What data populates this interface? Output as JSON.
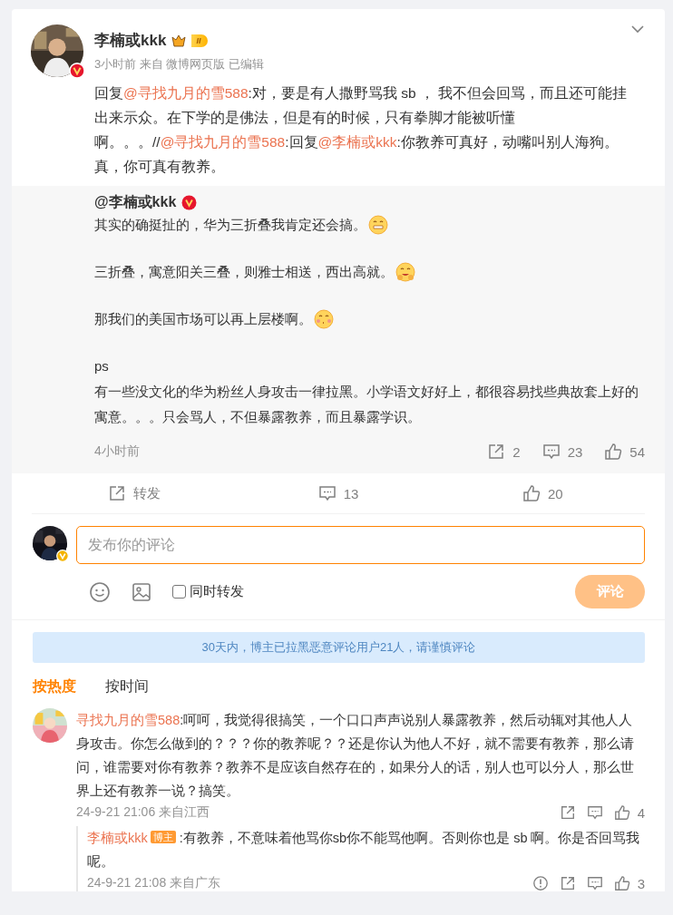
{
  "post": {
    "author": "李楠或kkk",
    "level_badge": "II",
    "verified": true,
    "meta": "3小时前 来自 微博网页版 已编辑",
    "body": [
      {
        "kind": "plain",
        "text": "回复"
      },
      {
        "kind": "mention",
        "text": "@寻找九月的雪588"
      },
      {
        "kind": "plain",
        "text": ":对，要是有人撒野骂我 sb ， 我不但会回骂，而且还可能挂出来示众。在下学的是佛法，但是有的时候，只有拳脚才能被听懂啊。。。//"
      },
      {
        "kind": "mention",
        "text": "@寻找九月的雪588"
      },
      {
        "kind": "plain",
        "text": ":回复"
      },
      {
        "kind": "mention",
        "text": "@李楠或kkk"
      },
      {
        "kind": "plain",
        "text": ":你教养可真好，动嘴叫别人海狗。真，你可真有教养。"
      }
    ],
    "repost": {
      "author": "@李楠或kkk",
      "verified": true,
      "paragraphs": [
        {
          "kind": "grin",
          "text": "其实的确挺扯的，华为三折叠我肯定还会搞。"
        },
        {
          "kind": "hug",
          "text": "三折叠，寓意阳关三叠，则雅士相送，西出高就。"
        },
        {
          "kind": "kiss",
          "text": "那我们的美国市场可以再上层楼啊。"
        },
        {
          "kind": "plain",
          "text": "ps\n有一些没文化的华为粉丝人身攻击一律拉黑。小学语文好好上，都很容易找些典故套上好的寓意。。。只会骂人，不但暴露教养，而且暴露学识。"
        }
      ],
      "time": "4小时前",
      "shares": "2",
      "comments": "23",
      "likes": "54"
    },
    "actions": {
      "share": "转发",
      "comments": "13",
      "likes": "20"
    }
  },
  "composer": {
    "placeholder": "发布你的评论",
    "repost_label": "同时转发",
    "repost_checked": false,
    "submit": "评论",
    "submit_disabled": true
  },
  "notice": "30天内，博主已拉黑恶意评论用户21人，请谨慎评论",
  "sort_tabs": [
    {
      "label": "按热度",
      "selected": true
    },
    {
      "label": "按时间",
      "selected": false
    }
  ],
  "comments": [
    {
      "author": "寻找九月的雪588",
      "text": ":呵呵，我觉得很搞笑，一个口口声声说别人暴露教养，然后动辄对其他人人身攻击。你怎么做到的？？？你的教养呢？？还是你认为他人不好，就不需要有教养，那么请问，谁需要对你有教养？教养不是应该自然存在的，如果分人的话，别人也可以分人，那么世界上还有教养一说？搞笑。",
      "time": "24-9-21 21:06 来自江西",
      "likes": "4",
      "replies": [
        {
          "author": "李楠或kkk",
          "badge": "博主",
          "text": " :有教养，不意味着他骂你sb你不能骂他啊。否则你也是 sb 啊。你是否回骂我呢。",
          "time": "24-9-21 21:08 来自广东",
          "likes": "3"
        }
      ]
    }
  ]
}
